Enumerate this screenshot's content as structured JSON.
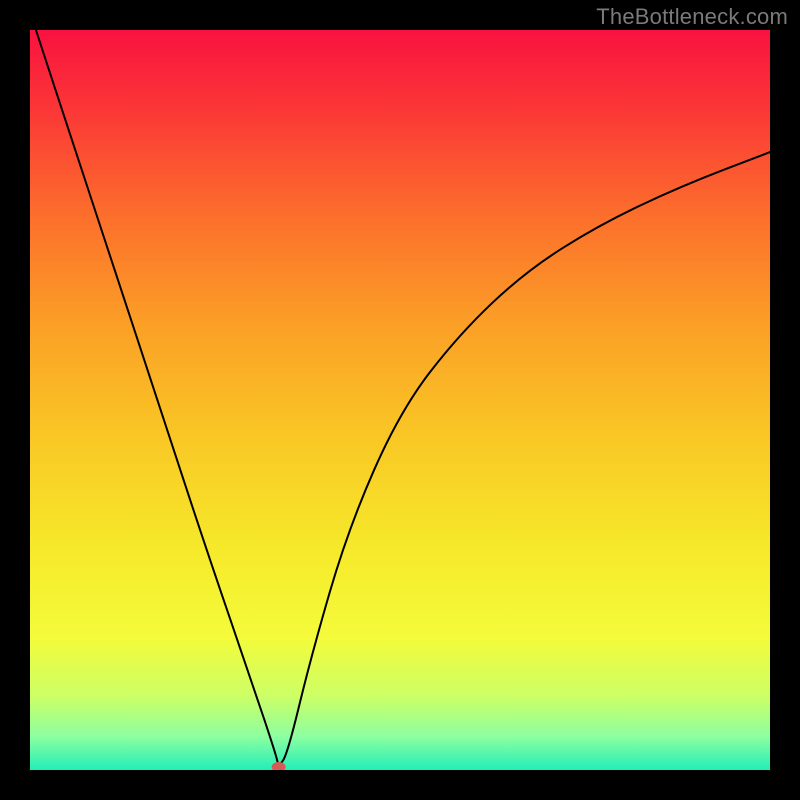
{
  "watermark": "TheBottleneck.com",
  "chart_data": {
    "type": "line",
    "title": "",
    "xlabel": "",
    "ylabel": "",
    "xlim": [
      0,
      100
    ],
    "ylim": [
      0,
      100
    ],
    "grid": false,
    "legend": false,
    "background": {
      "type": "gradient-vertical",
      "stops": [
        {
          "pos": 0.0,
          "hex": "#f91240"
        },
        {
          "pos": 0.1,
          "hex": "#fb3437"
        },
        {
          "pos": 0.25,
          "hex": "#fc6e2c"
        },
        {
          "pos": 0.4,
          "hex": "#fba026"
        },
        {
          "pos": 0.55,
          "hex": "#f9c725"
        },
        {
          "pos": 0.7,
          "hex": "#f6e92a"
        },
        {
          "pos": 0.82,
          "hex": "#f4fb3a"
        },
        {
          "pos": 0.9,
          "hex": "#ccff66"
        },
        {
          "pos": 0.955,
          "hex": "#8cffa0"
        },
        {
          "pos": 1.0,
          "hex": "#22eeb8"
        }
      ]
    },
    "series": [
      {
        "name": "bottleneck-curve",
        "stroke": "#000000",
        "stroke_width": 2,
        "x": [
          0.8,
          6,
          12,
          18,
          24,
          30,
          33.2,
          33.6,
          34.8,
          38,
          43,
          50,
          58,
          67,
          77,
          88,
          100
        ],
        "y": [
          100,
          84.1,
          65.9,
          47.6,
          29.3,
          11.8,
          2.2,
          0.4,
          2.2,
          15.4,
          32.6,
          48.5,
          58.9,
          67.4,
          73.7,
          78.9,
          83.5
        ]
      }
    ],
    "marker": {
      "x": 33.6,
      "y": 0.4,
      "hex": "#d85a57",
      "rx": 7,
      "ry": 5
    }
  }
}
